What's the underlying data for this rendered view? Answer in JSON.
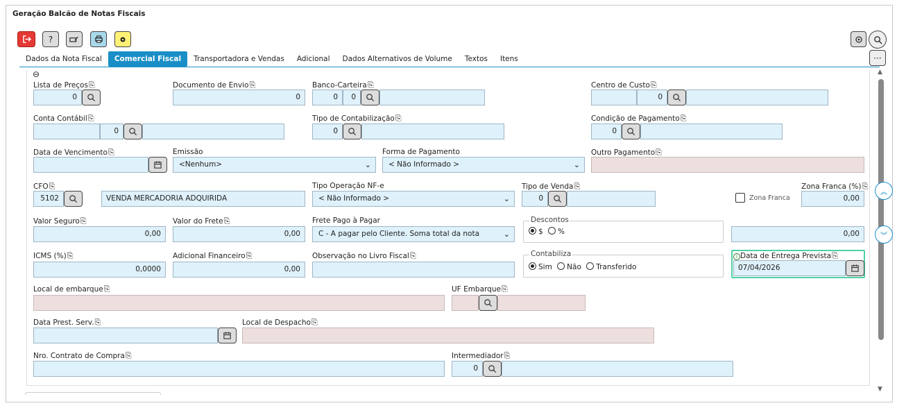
{
  "title": "Geração Balcão de Notas Fiscais",
  "tabs": [
    "Dados da Nota Fiscal",
    "Comercial Fiscal",
    "Transportadora e Vendas",
    "Adicional",
    "Dados Alternativos de Volume",
    "Textos",
    "Itens"
  ],
  "copy_glyph": "⎘",
  "colors": {
    "accent": "#1a8fc7",
    "input_bg": "#dff1fa",
    "disabled_bg": "#eedfdf",
    "exit_red": "#e53935",
    "config_yellow": "#fff176",
    "print_blue": "#a8d8ea",
    "focus_green": "#4fd1a5"
  },
  "toolbar": {
    "help_label": "?",
    "more_label": "···"
  },
  "collapse_glyph": "⊖",
  "fields": {
    "lista_precos": {
      "label": "Lista de Preços",
      "value": "0"
    },
    "documento_envio": {
      "label": "Documento de Envio",
      "value": "0"
    },
    "banco_carteira": {
      "label": "Banco-Carteira",
      "value1": "0",
      "value2": "0",
      "value3": ""
    },
    "centro_custo": {
      "label": "Centro de Custo",
      "value1": "",
      "value2": "0",
      "value3": ""
    },
    "conta_contabil": {
      "label": "Conta Contábil",
      "value1": "",
      "value2": "0",
      "value3": ""
    },
    "tipo_contabilizacao": {
      "label": "Tipo de Contabilização",
      "value": "0",
      "desc": ""
    },
    "condicao_pagamento": {
      "label": "Condição de Pagamento",
      "value": "0",
      "desc": ""
    },
    "data_vencimento": {
      "label": "Data de Vencimento",
      "value": ""
    },
    "emissao": {
      "label": "Emissão",
      "value": "<Nenhum>"
    },
    "forma_pagamento": {
      "label": "Forma de Pagamento",
      "value": "< Não Informado >"
    },
    "outro_pagamento": {
      "label": "Outro Pagamento",
      "value": ""
    },
    "cfo": {
      "label": "CFO",
      "value": "5102",
      "desc": "VENDA MERCADORIA ADQUIRIDA"
    },
    "tipo_operacao": {
      "label": "Tipo Operação NF-e",
      "value": "< Não Informado >"
    },
    "tipo_venda": {
      "label": "Tipo de Venda",
      "value": "0",
      "desc": ""
    },
    "zona_franca_chk": {
      "label": "Zona Franca",
      "checked": false
    },
    "zona_franca_pct": {
      "label": "Zona Franca (%)",
      "value": "0,00"
    },
    "valor_seguro": {
      "label": "Valor Seguro",
      "value": "0,00"
    },
    "valor_frete": {
      "label": "Valor do Frete",
      "value": "0,00"
    },
    "frete_pago": {
      "label": "Frete Pago à Pagar",
      "value": "C - A pagar pelo Cliente. Soma total da nota"
    },
    "descontos": {
      "legend": "Descontos",
      "opt1": "$",
      "opt2": "%",
      "selected": "$",
      "value": "0,00"
    },
    "icms": {
      "label": "ICMS (%)",
      "value": "0,0000"
    },
    "adicional_financeiro": {
      "label": "Adicional Financeiro",
      "value": "0,00"
    },
    "observacao_livro": {
      "label": "Observação no Livro Fiscal",
      "value": ""
    },
    "contabiliza": {
      "legend": "Contabiliza",
      "opt1": "Sim",
      "opt2": "Não",
      "opt3": "Transferido",
      "selected": "Sim"
    },
    "data_entrega": {
      "label": "Data de Entrega Prevista",
      "value": "07/04/2026"
    },
    "local_embarque": {
      "label": "Local de embarque",
      "value": ""
    },
    "uf_embarque": {
      "label": "UF Embarque",
      "value": ""
    },
    "data_prest_serv": {
      "label": "Data Prest. Serv.",
      "value": ""
    },
    "local_despacho": {
      "label": "Local de Despacho",
      "value": ""
    },
    "nro_contrato": {
      "label": "Nro. Contrato de Compra",
      "value": ""
    },
    "intermediador": {
      "label": "Intermediador",
      "value": "0",
      "desc": ""
    }
  }
}
